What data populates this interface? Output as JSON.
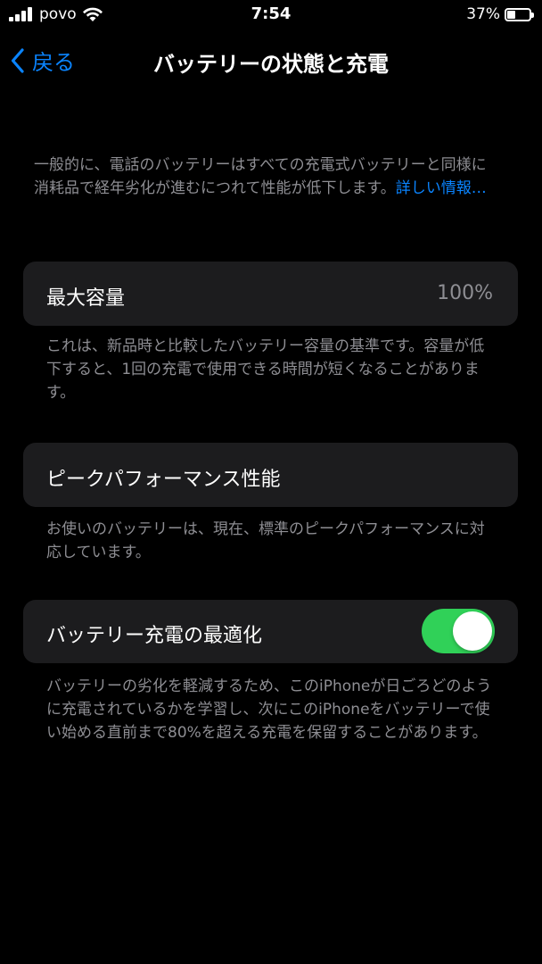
{
  "status_bar": {
    "carrier": "povo",
    "time": "7:54",
    "battery_percent": "37%",
    "battery_level": 0.37
  },
  "nav": {
    "back_label": "戻る",
    "title": "バッテリーの状態と充電"
  },
  "intro": {
    "text": "一般的に、電話のバッテリーはすべての充電式バッテリーと同様に消耗品で経年劣化が進むにつれて性能が低下します。",
    "link": "詳しい情報…"
  },
  "max_capacity": {
    "label": "最大容量",
    "value": "100%",
    "footnote": "これは、新品時と比較したバッテリー容量の基準です。容量が低下すると、1回の充電で使用できる時間が短くなることがあります。"
  },
  "peak_performance": {
    "label": "ピークパフォーマンス性能",
    "footnote": "お使いのバッテリーは、現在、標準のピークパフォーマンスに対応しています。"
  },
  "optimized_charging": {
    "label": "バッテリー充電の最適化",
    "enabled": true,
    "footnote": "バッテリーの劣化を軽減するため、このiPhoneが日ごろどのように充電されているかを学習し、次にこのiPhoneをバッテリーで使い始める直前まで80%を超える充電を保留することがあります。"
  },
  "colors": {
    "accent": "#0a84ff",
    "toggle_on": "#30d158",
    "card_bg": "#1c1c1e",
    "secondary_text": "#8e8e93"
  }
}
